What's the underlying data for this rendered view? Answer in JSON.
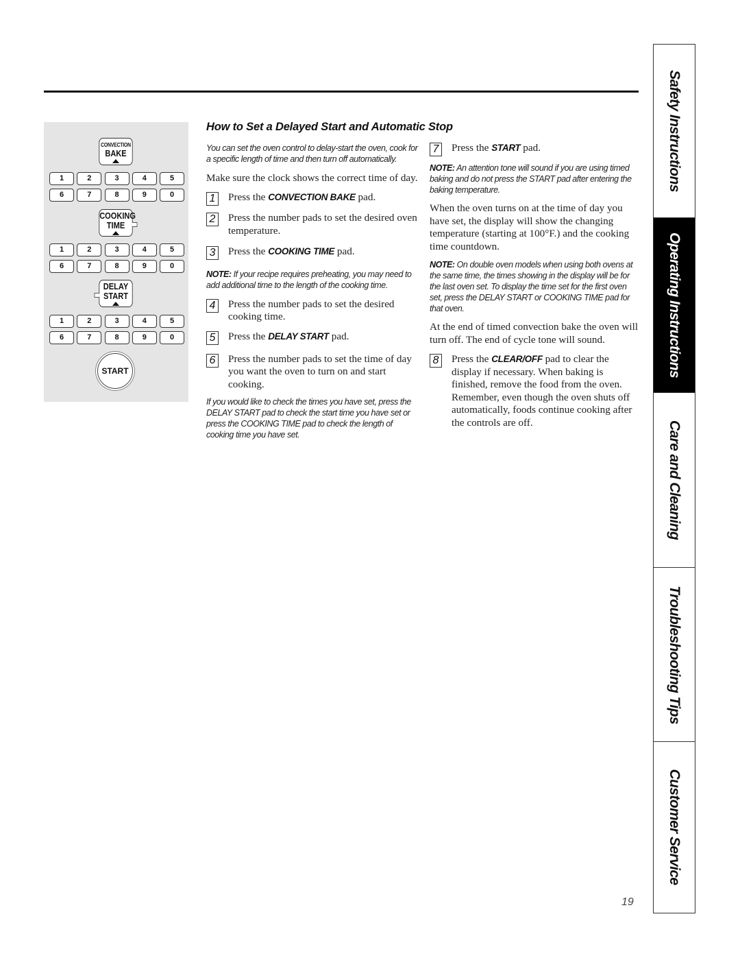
{
  "section": {
    "title": "How to Set a Delayed Start and Automatic Stop",
    "intro": "You can set the oven control to delay-start the oven, cook for a specific length of time and then turn off automatically.",
    "clock_note": "Make sure the clock shows the correct time of day."
  },
  "panel": {
    "convection_bake": {
      "small": "CONVECTION",
      "big": "BAKE"
    },
    "cooking_time": {
      "line1": "COOKING",
      "line2": "TIME"
    },
    "delay_start": {
      "line1": "DELAY",
      "line2": "START"
    },
    "start": "START",
    "keypad_row1": [
      "1",
      "2",
      "3",
      "4",
      "5"
    ],
    "keypad_row2": [
      "6",
      "7",
      "8",
      "9",
      "0"
    ]
  },
  "steps": [
    {
      "num": "1",
      "pre": "Press the ",
      "kw": "CONVECTION BAKE",
      "post": " pad."
    },
    {
      "num": "2",
      "pre": "Press the number pads to set the desired oven temperature.",
      "kw": "",
      "post": ""
    },
    {
      "num": "3",
      "pre": "Press the ",
      "kw": "COOKING TIME",
      "post": " pad."
    },
    {
      "num": "4",
      "pre": "Press the number pads to set the desired cooking time.",
      "kw": "",
      "post": ""
    },
    {
      "num": "5",
      "pre": "Press the ",
      "kw": "DELAY START",
      "post": " pad."
    },
    {
      "num": "6",
      "pre": "Press the number pads to set the time of day you want the oven to turn on and start cooking.",
      "kw": "",
      "post": ""
    },
    {
      "num": "7",
      "pre": "Press the ",
      "kw": "START",
      "post": " pad."
    },
    {
      "num": "8",
      "pre": "Press the ",
      "kw": "CLEAR/OFF",
      "post": " pad to clear the display if necessary. When baking is finished, remove the food from the oven. Remember, even though the oven shuts off automatically, foods continue cooking after the controls are off."
    }
  ],
  "notes": {
    "preheat": {
      "label": "NOTE:",
      "text": " If your recipe requires preheating, you may need to add additional time to the length of the cooking time."
    },
    "check_times": "If you would like to check the times you have set, press the DELAY START pad to check the start time you have set or press the COOKING TIME pad to check the length of cooking time you have set.",
    "attention_tone": {
      "label": "NOTE:",
      "text": " An attention tone will sound if you are using timed baking and do not press the START pad after entering the baking temperature."
    },
    "oven_on": "When the oven turns on at the time of day you have set, the display will show the changing temperature (starting at 100°F.) and the cooking time countdown.",
    "double_oven": {
      "label": "NOTE:",
      "text": " On double oven models when using both ovens at the same time, the times showing in the display will be for the last oven set. To display the time set for the first oven set, press the DELAY START or COOKING TIME pad for that oven."
    },
    "end_of_cycle": "At the end of timed convection bake the oven will turn off. The end of cycle tone will sound."
  },
  "side_tabs": [
    {
      "label": "Safety Instructions",
      "active": false
    },
    {
      "label": "Operating Instructions",
      "active": true
    },
    {
      "label": "Care and Cleaning",
      "active": false
    },
    {
      "label": "Troubleshooting Tips",
      "active": false
    },
    {
      "label": "Customer Service",
      "active": false
    }
  ],
  "page_number": "19"
}
